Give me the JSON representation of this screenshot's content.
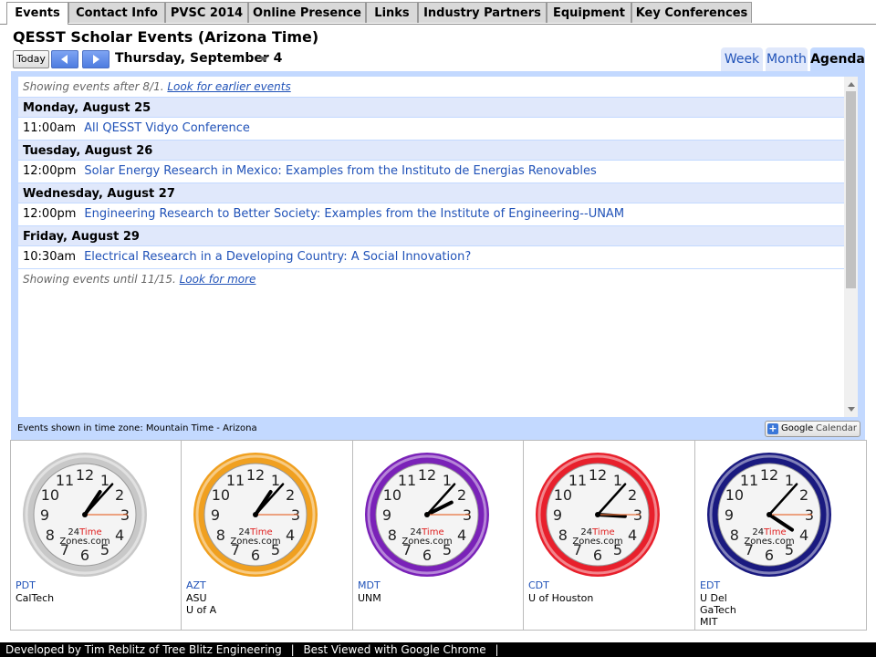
{
  "tabs": [
    {
      "label": "Events",
      "active": true
    },
    {
      "label": "Contact Info",
      "active": false
    },
    {
      "label": "PVSC 2014",
      "active": false
    },
    {
      "label": "Online Presence",
      "active": false
    },
    {
      "label": "Links",
      "active": false
    },
    {
      "label": "Industry Partners",
      "active": false
    },
    {
      "label": "Equipment",
      "active": false
    },
    {
      "label": "Key Conferences",
      "active": false
    }
  ],
  "calendar": {
    "title": "QESST Scholar Events (Arizona Time)",
    "today_label": "Today",
    "current_date": "Thursday, September 4",
    "view_tabs": [
      {
        "label": "Week",
        "active": false
      },
      {
        "label": "Month",
        "active": false
      },
      {
        "label": "Agenda",
        "active": true
      }
    ],
    "showing_before": {
      "text": "Showing events after 8/1.",
      "link": "Look for earlier events"
    },
    "days": [
      {
        "header": "Monday, August 25",
        "events": [
          {
            "time": "11:00am",
            "title": "All QESST Vidyo Conference"
          }
        ]
      },
      {
        "header": "Tuesday, August 26",
        "events": [
          {
            "time": "12:00pm",
            "title": "Solar Energy Research in Mexico: Examples from the Instituto de Energias Renovables"
          }
        ]
      },
      {
        "header": "Wednesday, August 27",
        "events": [
          {
            "time": "12:00pm",
            "title": "Engineering Research to Better Society: Examples from the Institute of Engineering--UNAM"
          }
        ]
      },
      {
        "header": "Friday, August 29",
        "events": [
          {
            "time": "10:30am",
            "title": "Electrical Research in a Developing Country: A Social Innovation?"
          }
        ]
      }
    ],
    "showing_after": {
      "text": "Showing events until 11/15.",
      "link": "Look for more"
    },
    "timezone_note": "Events shown in time zone: Mountain Time - Arizona",
    "gcal_button": {
      "brand": "Google",
      "label": "Calendar"
    }
  },
  "clocks": [
    {
      "code": "PDT",
      "places": [
        "CalTech"
      ],
      "ring_color": "#c8c8c8",
      "hour": 1,
      "minute": 7,
      "second": 15
    },
    {
      "code": "AZT",
      "places": [
        "ASU",
        "U of A"
      ],
      "ring_color": "#f0a020",
      "hour": 1,
      "minute": 7,
      "second": 15
    },
    {
      "code": "MDT",
      "places": [
        "UNM"
      ],
      "ring_color": "#7a22b8",
      "hour": 2,
      "minute": 7,
      "second": 15
    },
    {
      "code": "CDT",
      "places": [
        "U of Houston"
      ],
      "ring_color": "#e8202c",
      "hour": 3,
      "minute": 7,
      "second": 15
    },
    {
      "code": "EDT",
      "places": [
        "U Del",
        "GaTech",
        "MIT"
      ],
      "ring_color": "#1a1a80",
      "hour": 4,
      "minute": 7,
      "second": 15
    }
  ],
  "clock_brand": {
    "num": "24",
    "word": "Time",
    "site": "Zones.com"
  },
  "footer": {
    "items": [
      "Developed by Tim Reblitz of Tree Blitz Engineering",
      "Best Viewed with Google Chrome"
    ]
  }
}
